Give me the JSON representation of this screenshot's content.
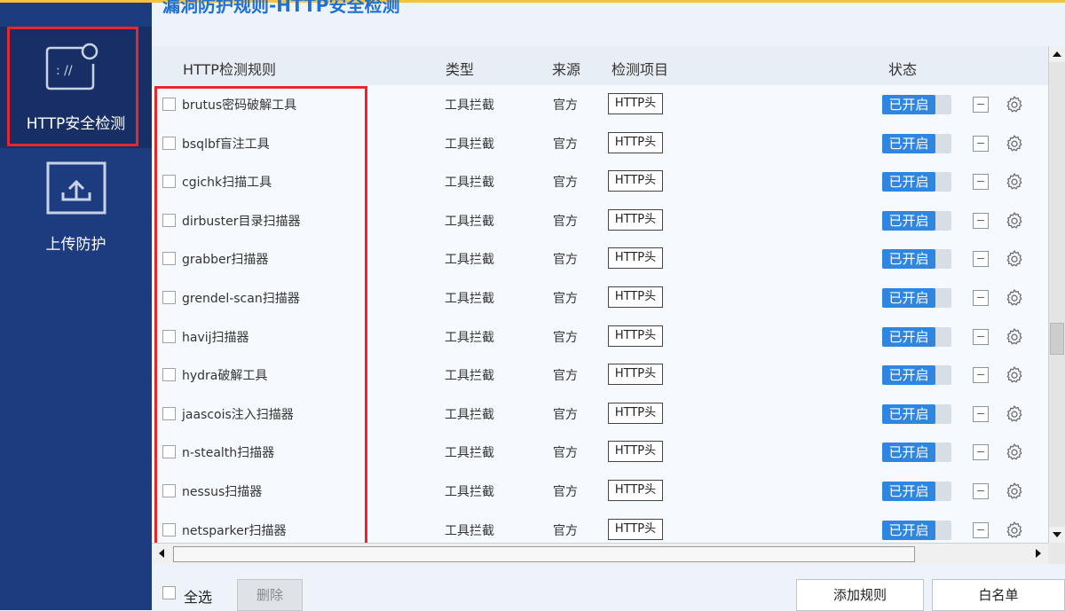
{
  "title": "漏洞防护规则-HTTP安全检测",
  "sidebar": {
    "items": [
      {
        "label": "HTTP安全检测",
        "icon": "http-shield-icon",
        "active": true
      },
      {
        "label": "上传防护",
        "icon": "upload-icon",
        "active": false
      }
    ]
  },
  "table": {
    "headers": {
      "rule": "HTTP检测规则",
      "type": "类型",
      "source": "来源",
      "item": "检测项目",
      "status": "状态"
    },
    "rows": [
      {
        "name": "brutus密码破解工具",
        "type": "工具拦截",
        "source": "官方",
        "item": "HTTP头",
        "status": "已开启"
      },
      {
        "name": "bsqlbf盲注工具",
        "type": "工具拦截",
        "source": "官方",
        "item": "HTTP头",
        "status": "已开启"
      },
      {
        "name": "cgichk扫描工具",
        "type": "工具拦截",
        "source": "官方",
        "item": "HTTP头",
        "status": "已开启"
      },
      {
        "name": "dirbuster目录扫描器",
        "type": "工具拦截",
        "source": "官方",
        "item": "HTTP头",
        "status": "已开启"
      },
      {
        "name": "grabber扫描器",
        "type": "工具拦截",
        "source": "官方",
        "item": "HTTP头",
        "status": "已开启"
      },
      {
        "name": "grendel-scan扫描器",
        "type": "工具拦截",
        "source": "官方",
        "item": "HTTP头",
        "status": "已开启"
      },
      {
        "name": "havij扫描器",
        "type": "工具拦截",
        "source": "官方",
        "item": "HTTP头",
        "status": "已开启"
      },
      {
        "name": "hydra破解工具",
        "type": "工具拦截",
        "source": "官方",
        "item": "HTTP头",
        "status": "已开启"
      },
      {
        "name": "jaascois注入扫描器",
        "type": "工具拦截",
        "source": "官方",
        "item": "HTTP头",
        "status": "已开启"
      },
      {
        "name": "n-stealth扫描器",
        "type": "工具拦截",
        "source": "官方",
        "item": "HTTP头",
        "status": "已开启"
      },
      {
        "name": "nessus扫描器",
        "type": "工具拦截",
        "source": "官方",
        "item": "HTTP头",
        "status": "已开启"
      },
      {
        "name": "netsparker扫描器",
        "type": "工具拦截",
        "source": "官方",
        "item": "HTTP头",
        "status": "已开启"
      }
    ]
  },
  "footer": {
    "select_all": "全选",
    "delete": "删除",
    "add_rule": "添加规则",
    "whitelist": "白名单"
  },
  "colors": {
    "sidebar": "#1d3c80",
    "accent": "#2f86e0",
    "highlight_box": "#e8262c"
  }
}
